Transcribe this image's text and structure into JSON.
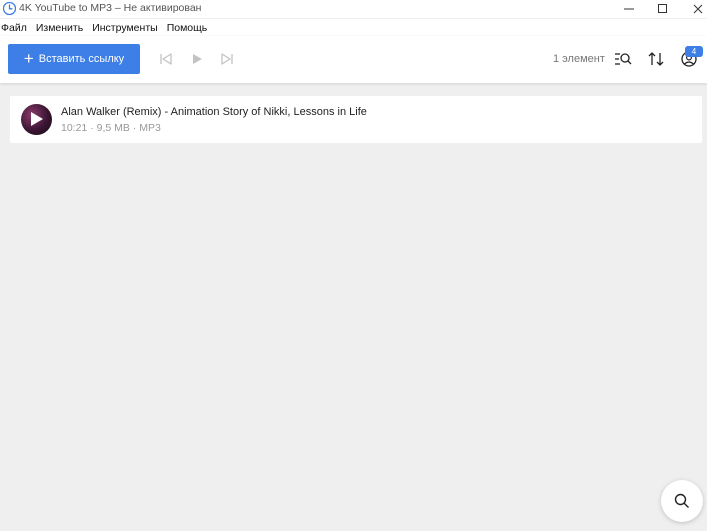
{
  "window": {
    "title": "4K YouTube to MP3 – Не активирован",
    "controls": [
      "minimize",
      "maximize",
      "close"
    ]
  },
  "menu": {
    "items": [
      "Файл",
      "Изменить",
      "Инструменты",
      "Помощь"
    ]
  },
  "toolbar": {
    "paste_label": "Вставить ссылку",
    "item_count": "1 элемент",
    "notifications_count": "4",
    "icons": [
      "previous-track-icon",
      "play-icon",
      "next-track-icon",
      "search-list-icon",
      "sort-icon",
      "account-icon"
    ]
  },
  "tracks": [
    {
      "title": "Alan Walker (Remix) - Animation Story of Nikki, Lessons in Life",
      "meta": "10:21 · 9,5 MB · MP3"
    }
  ],
  "colors": {
    "accent": "#3d7fe6",
    "background": "#efefef",
    "toolbar_bg": "#ffffff"
  }
}
